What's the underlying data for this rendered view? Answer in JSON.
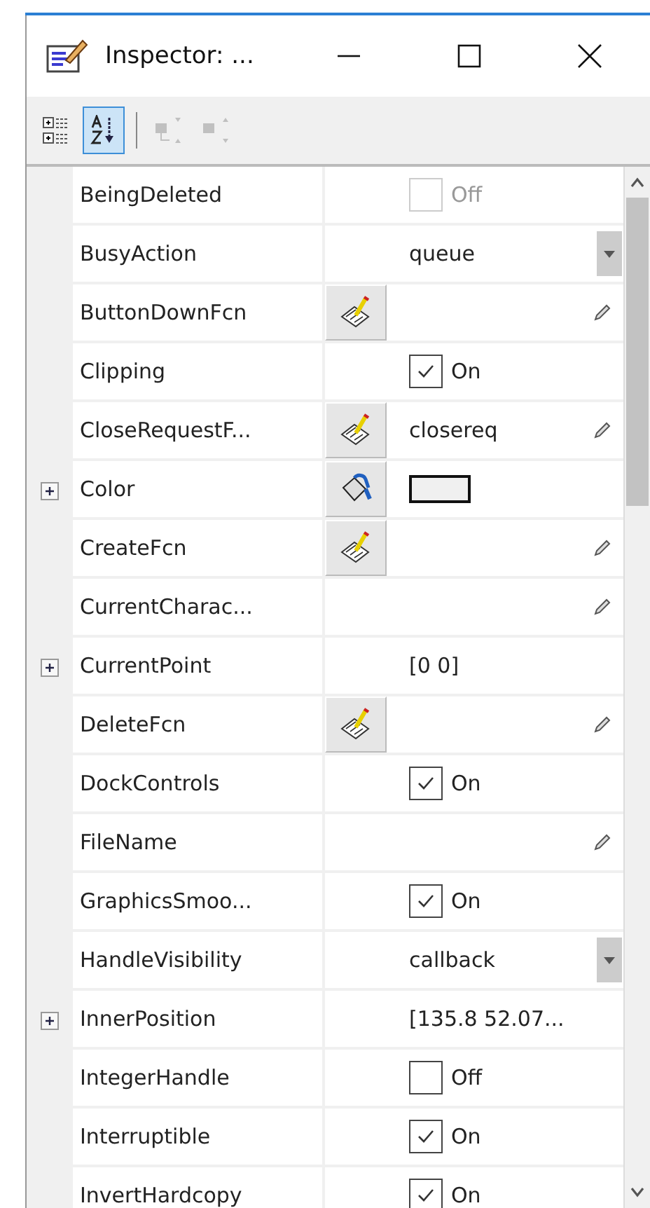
{
  "window": {
    "title": "Inspector: ..."
  },
  "toolbar": [
    {
      "kind": "categorized",
      "selected": false,
      "disabled": false
    },
    {
      "kind": "alphabetical",
      "selected": true,
      "disabled": false
    },
    {
      "kind": "collapse",
      "selected": false,
      "disabled": true
    },
    {
      "kind": "expand",
      "selected": false,
      "disabled": true
    }
  ],
  "rows": [
    {
      "name": "BeingDeleted",
      "expandable": false,
      "callback_editor": false,
      "kind": "check",
      "checked": false,
      "disabled": true,
      "value": "Off",
      "editable": false
    },
    {
      "name": "BusyAction",
      "expandable": false,
      "callback_editor": false,
      "kind": "dropdown",
      "value": "queue",
      "editable": false
    },
    {
      "name": "ButtonDownFcn",
      "expandable": false,
      "callback_editor": true,
      "kind": "text",
      "editable": true
    },
    {
      "name": "Clipping",
      "expandable": false,
      "callback_editor": false,
      "kind": "check",
      "checked": true,
      "disabled": false,
      "value": "On",
      "editable": false
    },
    {
      "name": "CloseRequestF...",
      "expandable": false,
      "callback_editor": true,
      "kind": "text",
      "value": "closereq",
      "editable": true
    },
    {
      "name": "Color",
      "expandable": true,
      "callback_editor": false,
      "kind": "color",
      "color": "#f0f0f0",
      "editable": false
    },
    {
      "name": "CreateFcn",
      "expandable": false,
      "callback_editor": true,
      "kind": "text",
      "editable": true
    },
    {
      "name": "CurrentCharac...",
      "expandable": false,
      "callback_editor": false,
      "kind": "text",
      "editable": true
    },
    {
      "name": "CurrentPoint",
      "expandable": true,
      "callback_editor": false,
      "kind": "text",
      "value": "[0 0]",
      "editable": false
    },
    {
      "name": "DeleteFcn",
      "expandable": false,
      "callback_editor": true,
      "kind": "text",
      "editable": true
    },
    {
      "name": "DockControls",
      "expandable": false,
      "callback_editor": false,
      "kind": "check",
      "checked": true,
      "disabled": false,
      "value": "On",
      "editable": false
    },
    {
      "name": "FileName",
      "expandable": false,
      "callback_editor": false,
      "kind": "text",
      "editable": true
    },
    {
      "name": "GraphicsSmoo...",
      "expandable": false,
      "callback_editor": false,
      "kind": "check",
      "checked": true,
      "disabled": false,
      "value": "On",
      "editable": false
    },
    {
      "name": "HandleVisibility",
      "expandable": false,
      "callback_editor": false,
      "kind": "dropdown",
      "value": "callback",
      "editable": false
    },
    {
      "name": "InnerPosition",
      "expandable": true,
      "callback_editor": false,
      "kind": "text",
      "value": "[135.8 52.07...",
      "editable": false
    },
    {
      "name": "IntegerHandle",
      "expandable": false,
      "callback_editor": false,
      "kind": "check",
      "checked": false,
      "disabled": false,
      "value": "Off",
      "editable": false
    },
    {
      "name": "Interruptible",
      "expandable": false,
      "callback_editor": false,
      "kind": "check",
      "checked": true,
      "disabled": false,
      "value": "On",
      "editable": false
    },
    {
      "name": "InvertHardcopy",
      "expandable": false,
      "callback_editor": false,
      "kind": "check",
      "checked": true,
      "disabled": false,
      "value": "On",
      "editable": false
    }
  ]
}
